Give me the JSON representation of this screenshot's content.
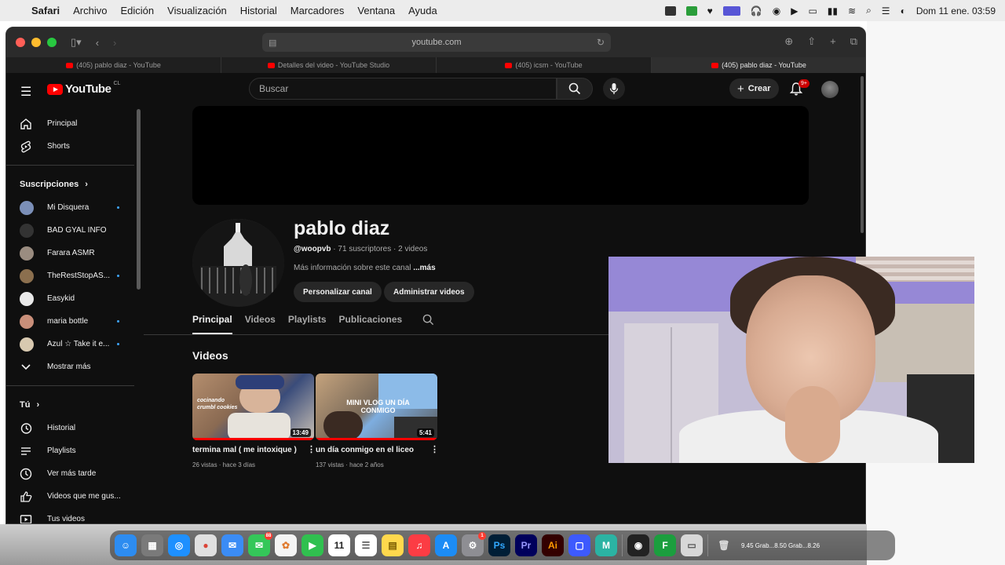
{
  "menubar": {
    "app": "Safari",
    "items": [
      "Archivo",
      "Edición",
      "Visualización",
      "Historial",
      "Marcadores",
      "Ventana",
      "Ayuda"
    ],
    "datetime": "Dom 11 ene.  03:59"
  },
  "browser": {
    "url": "youtube.com",
    "tabs": [
      {
        "title": "(405) pablo diaz - YouTube",
        "active": false
      },
      {
        "title": "Detalles del video - YouTube Studio",
        "active": false
      },
      {
        "title": "(405) icsm - YouTube",
        "active": false
      },
      {
        "title": "(405) pablo diaz - YouTube",
        "active": true
      }
    ]
  },
  "youtube": {
    "logo_text": "YouTube",
    "country_code": "CL",
    "search_placeholder": "Buscar",
    "create_label": "Crear",
    "notif_badge": "9+"
  },
  "sidebar": {
    "main": [
      {
        "label": "Principal",
        "icon": "home-icon"
      },
      {
        "label": "Shorts",
        "icon": "shorts-icon"
      }
    ],
    "subs_heading": "Suscripciones",
    "subs": [
      {
        "label": "Mi Disquera",
        "dot": true,
        "color": "#7b8fb8"
      },
      {
        "label": "BAD GYAL INFO",
        "dot": false,
        "color": "#333333"
      },
      {
        "label": "Farara ASMR",
        "dot": false,
        "color": "#9a8c80"
      },
      {
        "label": "TheRestStopAS...",
        "dot": true,
        "color": "#8b6f4e"
      },
      {
        "label": "Easykid",
        "dot": false,
        "color": "#e8e8e8"
      },
      {
        "label": "maria bottle",
        "dot": true,
        "color": "#c98f7a"
      },
      {
        "label": "Azul ☆ Take it e...",
        "dot": true,
        "color": "#d8c9b0"
      }
    ],
    "show_more": "Mostrar más",
    "you_heading": "Tú",
    "you": [
      {
        "label": "Historial",
        "icon": "history-icon"
      },
      {
        "label": "Playlists",
        "icon": "playlists-icon"
      },
      {
        "label": "Ver más tarde",
        "icon": "watch-later-icon"
      },
      {
        "label": "Videos que me gus...",
        "icon": "thumbs-up-icon"
      },
      {
        "label": "Tus videos",
        "icon": "your-videos-icon"
      }
    ]
  },
  "channel": {
    "name": "pablo diaz",
    "handle": "@woopvb",
    "stats": " · 71 suscriptores · 2 videos",
    "more_info": "Más información sobre este canal ",
    "more_link": "...más",
    "customize_btn": "Personalizar canal",
    "manage_btn": "Administrar videos",
    "tabs": [
      "Principal",
      "Videos",
      "Playlists",
      "Publicaciones"
    ],
    "section_title": "Videos",
    "videos": [
      {
        "title": "termina mal ( me intoxique )",
        "meta": "26 vistas · hace 3 días",
        "duration": "13:49",
        "thumb_text": "cocinando crumbl cookies"
      },
      {
        "title": "un día conmigo en el liceo",
        "meta": "137 vistas · hace 2 años",
        "duration": "5:41",
        "thumb_text": "MINI VLOG UN DÍA CONMIGO"
      }
    ]
  },
  "dock": {
    "apps": [
      {
        "name": "finder",
        "color": "#2d8cf0",
        "glyph": "☺"
      },
      {
        "name": "launchpad",
        "color": "#7a7a7a",
        "glyph": "▦"
      },
      {
        "name": "safari",
        "color": "#1e90ff",
        "glyph": "◎"
      },
      {
        "name": "chrome",
        "color": "#e0e0e0",
        "glyph": "●"
      },
      {
        "name": "mail",
        "color": "#3b8cf5",
        "glyph": "✉"
      },
      {
        "name": "messages",
        "color": "#34c759",
        "glyph": "💬",
        "badge": "88"
      },
      {
        "name": "photos",
        "color": "#f4f4f4",
        "glyph": "✿"
      },
      {
        "name": "facetime",
        "color": "#30c04f",
        "glyph": "▶"
      },
      {
        "name": "calendar",
        "color": "#ffffff",
        "glyph": "11"
      },
      {
        "name": "reminders",
        "color": "#ffffff",
        "glyph": "☰"
      },
      {
        "name": "notes",
        "color": "#ffd84d",
        "glyph": "▤"
      },
      {
        "name": "music",
        "color": "#fc3c44",
        "glyph": "♫"
      },
      {
        "name": "app-store",
        "color": "#1c8cf5",
        "glyph": "A"
      },
      {
        "name": "system-settings",
        "color": "#8e8e93",
        "glyph": "⚙",
        "badge": "1"
      },
      {
        "name": "photoshop",
        "color": "#001e36",
        "glyph": "Ps"
      },
      {
        "name": "premiere",
        "color": "#00005b",
        "glyph": "Pr"
      },
      {
        "name": "illustrator",
        "color": "#330000",
        "glyph": "Ai"
      },
      {
        "name": "notchnook",
        "color": "#3d5afe",
        "glyph": "▢"
      },
      {
        "name": "mapp",
        "color": "#2bb3a3",
        "glyph": "M"
      }
    ],
    "right_apps": [
      {
        "name": "obs",
        "color": "#222222",
        "glyph": "◉"
      },
      {
        "name": "f-app",
        "color": "#1b9e3e",
        "glyph": "F"
      },
      {
        "name": "preview",
        "color": "#d7d7d7",
        "glyph": "▭"
      }
    ],
    "trash_label": "9.45  Grab...8.50  Grab...8.26"
  }
}
